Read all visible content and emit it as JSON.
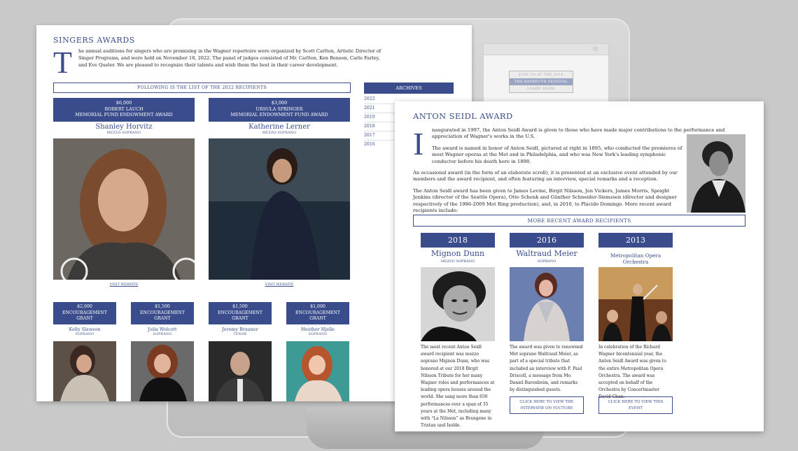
{
  "monitor": {
    "promo_top": "JOIN US AT THE 2024",
    "promo_mid": "THE BAYREUTH FESTIVAL",
    "promo_bottom": "LEARN MORE",
    "star": "☆"
  },
  "left": {
    "title": "SINGERS AWARDS",
    "dropcap": "T",
    "intro": "he annual auditions for singers who are promising in the Wagner repertoire were organized by Scott Carlton, Artistic Director of Singer Programs, and were held on November 18, 2022. The panel of judges consisted of Mr. Carlton, Ken Benson, Carle Farley, and Eve Queler. We are pleased to recognize their talents and wish them the best in their career development.",
    "list_heading": "FOLLOWING IS THE LIST OF THE 2022 RECIPIENTS",
    "major": [
      {
        "amount": "$6,000",
        "donor": "ROBERT LAUCH",
        "award": "MEMORIAL FUND ENDOWMENT AWARD",
        "name": "Shanley Horvitz",
        "voice": "MEZZO-SOPRANO",
        "link": "VISIT WEBSITE"
      },
      {
        "amount": "$3,000",
        "donor": "URSULA SPRINGER",
        "award": "MEMORIAL ENDOWMENT FUND AWARD",
        "name": "Katherine Lerner",
        "voice": "MEZZO-SOPRANO",
        "link": "VISIT WEBSITE"
      }
    ],
    "grants": [
      {
        "amount": "$2,000",
        "line1": "ENCOURAGEMENT",
        "line2": "GRANT",
        "name": "Kelly Slawson",
        "voice": "SOPRANO"
      },
      {
        "amount": "$1,500",
        "line1": "ENCOURAGEMENT",
        "line2": "GRANT",
        "name": "Julia Wolcott",
        "voice": "SOPRANO"
      },
      {
        "amount": "$1,500",
        "line1": "ENCOURAGEMENT",
        "line2": "GRANT",
        "name": "Jeremy Brauner",
        "voice": "TENOR"
      },
      {
        "amount": "$1,000",
        "line1": "ENCOURAGEMENT",
        "line2": "GRANT",
        "name": "Heather Hjelle",
        "voice": "SOPRANO"
      }
    ],
    "archives": {
      "heading": "ARCHIVES",
      "years": [
        "2022",
        "2021",
        "2019",
        "2018",
        "2017",
        "2016"
      ]
    }
  },
  "right": {
    "title": "ANTON SEIDL AWARD",
    "dropcap": "I",
    "p1": "naugurated in 1997, the Anton Seidl Award is given to those who have made major contributions to the performance and appreciation of Wagner's works in the U.S.",
    "p2": "The award is named in honor of Anton Seidl, pictured at right in 1895, who conducted the premieres of most Wagner operas at the Met and in Philadelphia, and who was New York's leading symphonic conductor before his death here in 1898.",
    "p3": "An occasional award (in the form of an elaborate scroll), it is presented at an exclusive event attended by our members and the award recipient, and often featuring an interview, special remarks and a reception.",
    "p4": "The Anton Seidl award has been given to James Levine, Birgit Nilsson, Jon Vickers, James Morris, Speight Jenkins (director of the Seattle Opera), Otto Schenk and Günther Schneider-Siemssen (director and designer respectively of the 1986-2009 Met Ring production), and, in 2010, to Plácido Domingo. More recent award recipients include:",
    "recent_heading": "MORE RECENT AWARD RECIPIENTS",
    "recipients": [
      {
        "year": "2018",
        "name": "Mignon Dunn",
        "voice": "MEZZO SOPRANO",
        "text": "The most recent Anton Seidl award recipient was mezzo soprano Mignon Dunn, who was honored at our 2018 Birgit Nilsson Tribute for her many Wagner roles and performances at leading opera houses around the world. She sang more than 650 performances over a span of 35 years at the Met, including many with “La Nilsson” as Brangene in Tristan und Isolde.",
        "button": ""
      },
      {
        "year": "2016",
        "name": "Waltraud Meier",
        "voice": "SOPRANO",
        "text": "The award was given to renowned Met soprano Waltraud Meier, as part of a special tribute that included an interview with F. Paul Driscoll, a message from Mo. Daniel Barenboim, and remarks by distinguished guests.",
        "button": "CLICK HERE TO VIEW THE INTERVIEW ON YOUTUBE"
      },
      {
        "year": "2013",
        "name": "Metropolitan Opera Orchestra",
        "voice": "",
        "text": "In celebration of the Richard Wagner bicentennial year, the Anton Seidl Award was given to the entire Metropolitan Opera Orchestra. The award was accepted on behalf of the Orchestra by Concertmaster David Chan.",
        "button": "CLICK HERE TO VIEW THIS EVENT"
      }
    ]
  }
}
